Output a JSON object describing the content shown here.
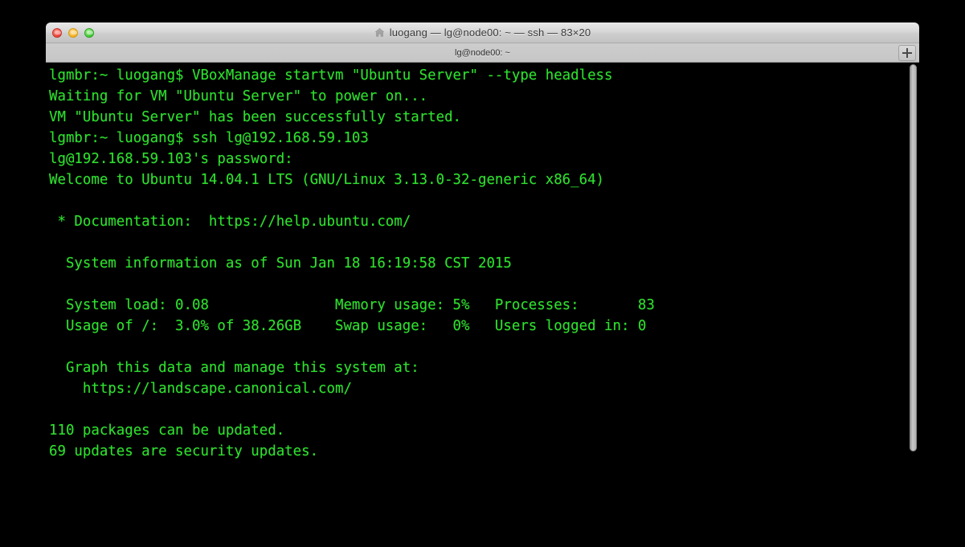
{
  "window": {
    "title": "luogang — lg@node00: ~ — ssh — 83×20",
    "home_icon": "home-icon",
    "traffic_lights": {
      "close_label": "Close",
      "minimize_label": "Minimize",
      "maximize_label": "Maximize",
      "close_color": "#e84238",
      "minimize_color": "#f5b324",
      "maximize_color": "#41c935"
    }
  },
  "tabbar": {
    "tabs": [
      {
        "label": "lg@node00: ~",
        "active": true
      }
    ],
    "new_tab_label": "+"
  },
  "terminal": {
    "background_color": "#000000",
    "text_color": "#2ee02e",
    "columns": 83,
    "rows": 20,
    "lines": [
      "lgmbr:~ luogang$ VBoxManage startvm \"Ubuntu Server\" --type headless",
      "Waiting for VM \"Ubuntu Server\" to power on...",
      "VM \"Ubuntu Server\" has been successfully started.",
      "lgmbr:~ luogang$ ssh lg@192.168.59.103",
      "lg@192.168.59.103's password:",
      "Welcome to Ubuntu 14.04.1 LTS (GNU/Linux 3.13.0-32-generic x86_64)",
      "",
      " * Documentation:  https://help.ubuntu.com/",
      "",
      "  System information as of Sun Jan 18 16:19:58 CST 2015",
      "",
      "  System load: 0.08               Memory usage: 5%   Processes:       83",
      "  Usage of /:  3.0% of 38.26GB    Swap usage:   0%   Users logged in: 0",
      "",
      "  Graph this data and manage this system at:",
      "    https://landscape.canonical.com/",
      "",
      "110 packages can be updated.",
      "69 updates are security updates.",
      ""
    ]
  },
  "scrollbar": {
    "orientation": "vertical",
    "thumb_position_percent": 0
  }
}
